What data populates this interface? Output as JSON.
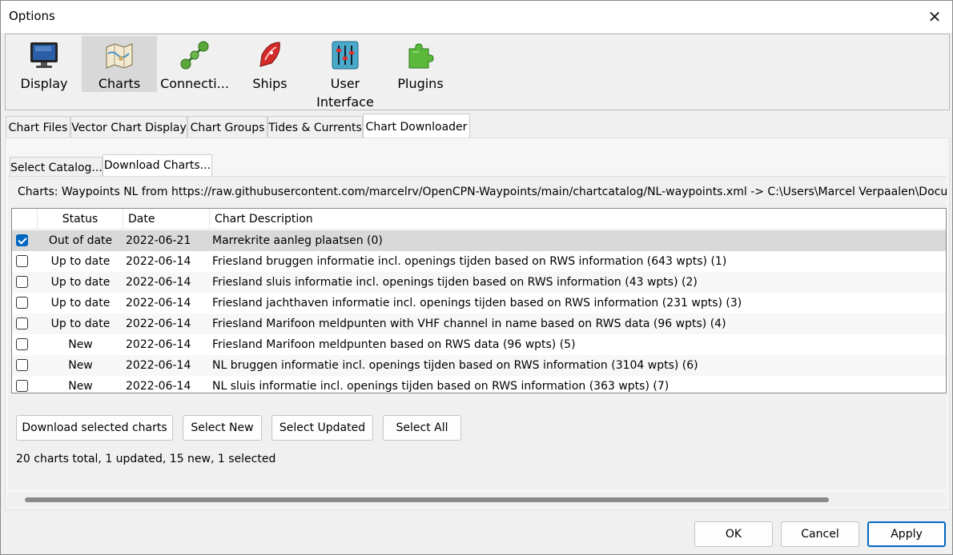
{
  "window": {
    "title": "Options",
    "close_glyph": "✕"
  },
  "toolbar": {
    "items": [
      {
        "label": "Display",
        "icon": "monitor-icon"
      },
      {
        "label": "Charts",
        "icon": "charts-icon",
        "selected": true
      },
      {
        "label": "Connecti...",
        "icon": "connections-icon"
      },
      {
        "label": "Ships",
        "icon": "ship-icon"
      },
      {
        "label": "User",
        "label2": "Interface",
        "icon": "sliders-icon"
      },
      {
        "label": "Plugins",
        "icon": "puzzle-icon"
      }
    ]
  },
  "tabs": [
    "Chart Files",
    "Vector Chart Display",
    "Chart Groups",
    "Tides & Currents",
    "Chart Downloader"
  ],
  "subtabs": [
    "Select Catalog...",
    "Download Charts..."
  ],
  "catalog_line": "Charts: Waypoints NL from https://raw.githubusercontent.com/marcelrv/OpenCPN-Waypoints/main/chartcatalog/NL-waypoints.xml -> C:\\Users\\Marcel Verpaalen\\Documents\\Charts",
  "list": {
    "headers": [
      "Status",
      "Date",
      "Chart Description"
    ],
    "rows": [
      {
        "checked": true,
        "status": "Out of date",
        "date": "2022-06-21",
        "desc": "Marrekrite aanleg plaatsen (0)"
      },
      {
        "checked": false,
        "status": "Up to date",
        "date": "2022-06-14",
        "desc": "Friesland bruggen informatie incl. openings tijden based on RWS information (643 wpts) (1)"
      },
      {
        "checked": false,
        "status": "Up to date",
        "date": "2022-06-14",
        "desc": "Friesland sluis informatie incl. openings tijden based on RWS information (43 wpts) (2)"
      },
      {
        "checked": false,
        "status": "Up to date",
        "date": "2022-06-14",
        "desc": "Friesland jachthaven informatie incl. openings tijden based on RWS information (231 wpts) (3)"
      },
      {
        "checked": false,
        "status": "Up to date",
        "date": "2022-06-14",
        "desc": "Friesland Marifoon meldpunten with VHF channel in name based on RWS data (96 wpts) (4)"
      },
      {
        "checked": false,
        "status": "New",
        "date": "2022-06-14",
        "desc": "Friesland Marifoon meldpunten based on RWS data (96 wpts) (5)"
      },
      {
        "checked": false,
        "status": "New",
        "date": "2022-06-14",
        "desc": "NL bruggen informatie incl. openings tijden based on RWS information (3104 wpts) (6)"
      },
      {
        "checked": false,
        "status": "New",
        "date": "2022-06-14",
        "desc": "NL sluis informatie incl. openings tijden based on RWS information (363 wpts) (7)"
      }
    ]
  },
  "buttons": {
    "download": "Download selected charts",
    "select_new": "Select New",
    "select_updated": "Select Updated",
    "select_all": "Select All"
  },
  "summary": "20 charts total, 1 updated, 15 new, 1 selected",
  "dialog_buttons": {
    "ok": "OK",
    "cancel": "Cancel",
    "apply": "Apply"
  }
}
